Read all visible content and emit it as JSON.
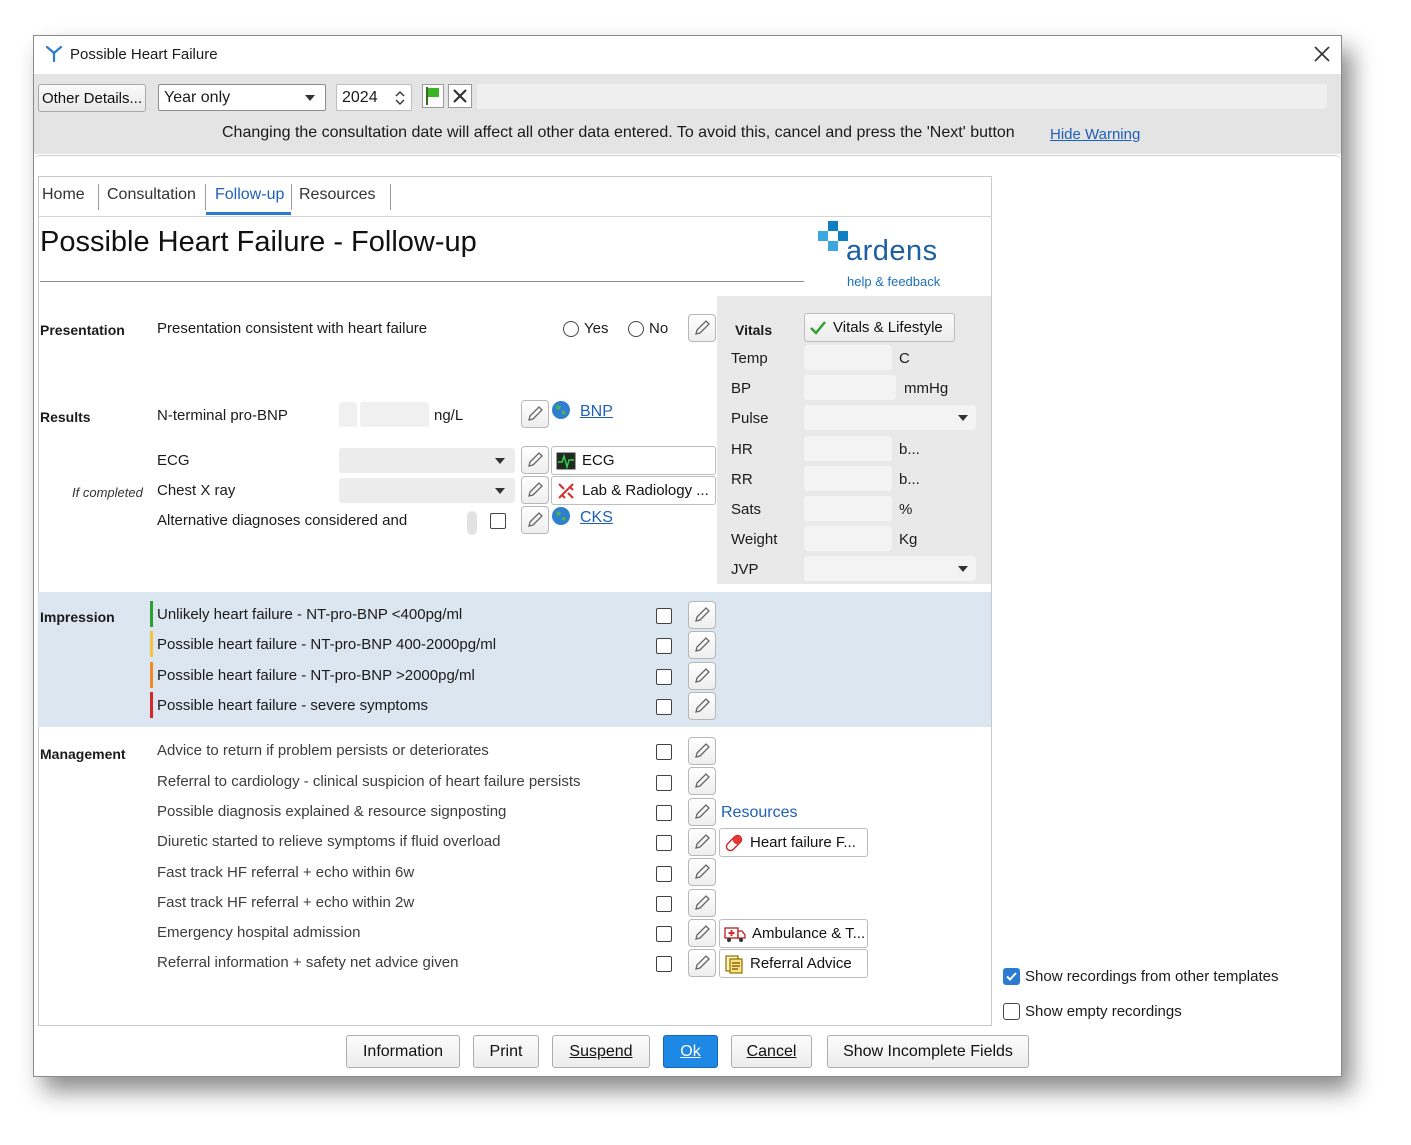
{
  "window": {
    "title": "Possible Heart Failure"
  },
  "toolbar": {
    "other_details_label": "Other Details...",
    "date_mode": "Year only",
    "year": "2024",
    "warning_text": "Changing the consultation date will affect all other data entered. To avoid this, cancel and press the 'Next' button",
    "hide_warning_label": "Hide Warning"
  },
  "tabs": [
    {
      "label": "Home"
    },
    {
      "label": "Consultation"
    },
    {
      "label": "Follow-up",
      "active": true
    },
    {
      "label": "Resources"
    }
  ],
  "page_title": "Possible Heart Failure - Follow-up",
  "logo": {
    "brand": "ardens",
    "tagline": "help & feedback"
  },
  "presentation": {
    "section": "Presentation",
    "text": "Presentation consistent with heart failure",
    "yes_label": "Yes",
    "no_label": "No"
  },
  "results": {
    "section": "Results",
    "ntprobnp_label": "N-terminal pro-BNP",
    "ntprobnp_unit": "ng/L",
    "bnp_link": "BNP",
    "ecg_label": "ECG",
    "ecg_button": "ECG",
    "if_completed": "If completed",
    "cxr_label": "Chest X ray",
    "lab_button": "Lab & Radiology ...",
    "alt_diag_label": "Alternative diagnoses considered and",
    "cks_link": "CKS"
  },
  "vitals": {
    "section": "Vitals",
    "vitals_button": "Vitals & Lifestyle",
    "rows": [
      {
        "label": "Temp",
        "unit": "C"
      },
      {
        "label": "BP",
        "unit": "mmHg"
      },
      {
        "label": "Pulse",
        "unit": ""
      },
      {
        "label": "HR",
        "unit": "b..."
      },
      {
        "label": "RR",
        "unit": "b..."
      },
      {
        "label": "Sats",
        "unit": "%"
      },
      {
        "label": "Weight",
        "unit": "Kg"
      },
      {
        "label": "JVP",
        "unit": ""
      }
    ]
  },
  "impression": {
    "section": "Impression",
    "items": [
      {
        "text": "Unlikely heart failure - NT-pro-BNP <400pg/ml",
        "color": "#2ca02c"
      },
      {
        "text": "Possible heart failure - NT-pro-BNP 400-2000pg/ml",
        "color": "#f5c242"
      },
      {
        "text": "Possible heart failure - NT-pro-BNP >2000pg/ml",
        "color": "#f08a24"
      },
      {
        "text": "Possible heart failure - severe symptoms",
        "color": "#d62728"
      }
    ]
  },
  "management": {
    "section": "Management",
    "items": [
      {
        "text": "Advice to return if problem persists or deteriorates"
      },
      {
        "text": "Referral to cardiology - clinical suspicion of heart failure persists"
      },
      {
        "text": "Possible diagnosis explained & resource signposting",
        "link": "Resources"
      },
      {
        "text": "Diuretic started to relieve symptoms if fluid overload",
        "button": "Heart failure F...",
        "icon": "pill-icon"
      },
      {
        "text": "Fast track HF referral + echo within 6w"
      },
      {
        "text": "Fast track HF referral + echo within 2w"
      },
      {
        "text": "Emergency hospital admission",
        "button": "Ambulance & T...",
        "icon": "ambulance-icon"
      },
      {
        "text": "Referral information + safety net advice given",
        "button": "Referral Advice",
        "icon": "document-icon"
      }
    ]
  },
  "options": {
    "show_other_templates": {
      "label": "Show recordings from other templates",
      "checked": true
    },
    "show_empty": {
      "label": "Show empty recordings",
      "checked": false
    }
  },
  "footer": {
    "information": "Information",
    "print": "Print",
    "suspend": "Suspend",
    "ok": "Ok",
    "cancel": "Cancel",
    "show_incomplete": "Show Incomplete Fields"
  },
  "colors": {
    "accent": "#1e88e5",
    "link": "#1f5fb8",
    "impression_band": "#dce6f1",
    "ok_button": "#1e88e5"
  }
}
